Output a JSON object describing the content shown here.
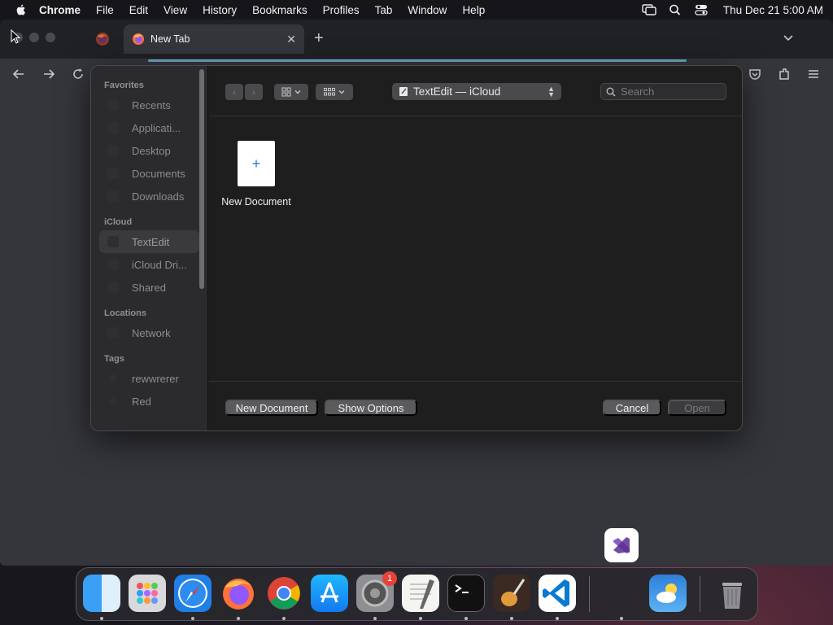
{
  "menubar": {
    "app_name": "Chrome",
    "items": [
      "File",
      "Edit",
      "View",
      "History",
      "Bookmarks",
      "Profiles",
      "Tab",
      "Window",
      "Help"
    ],
    "clock": "Thu Dec 21  5:00 AM"
  },
  "browser": {
    "tab_title": "New Tab",
    "new_tab_symbol": "+",
    "close_symbol": "✕"
  },
  "dialog": {
    "location": "TextEdit — iCloud",
    "search_placeholder": "Search",
    "sidebar": {
      "favorites_label": "Favorites",
      "favorites": [
        "Recents",
        "Applicati...",
        "Desktop",
        "Documents",
        "Downloads"
      ],
      "icloud_label": "iCloud",
      "icloud": [
        "TextEdit",
        "iCloud Dri...",
        "Shared"
      ],
      "locations_label": "Locations",
      "locations": [
        "Network"
      ],
      "tags_label": "Tags",
      "tags": [
        "rewwrerer",
        "Red"
      ]
    },
    "files": [
      {
        "name": "New Document",
        "glyph": "+"
      }
    ],
    "buttons": {
      "new_document": "New Document",
      "show_options": "Show Options",
      "cancel": "Cancel",
      "open": "Open"
    }
  },
  "dock": {
    "apps": [
      "Finder",
      "Launchpad",
      "Safari",
      "Firefox",
      "Chrome",
      "App Store",
      "System Settings",
      "TextEdit",
      "Terminal",
      "GarageBand",
      "Visual Studio Code",
      "Weather",
      "Trash"
    ],
    "settings_badge": "1"
  },
  "colors": {
    "accent_blue": "#2a7bd8",
    "focus_ring": "#6ba6c6",
    "badge_red": "#e5423a"
  }
}
